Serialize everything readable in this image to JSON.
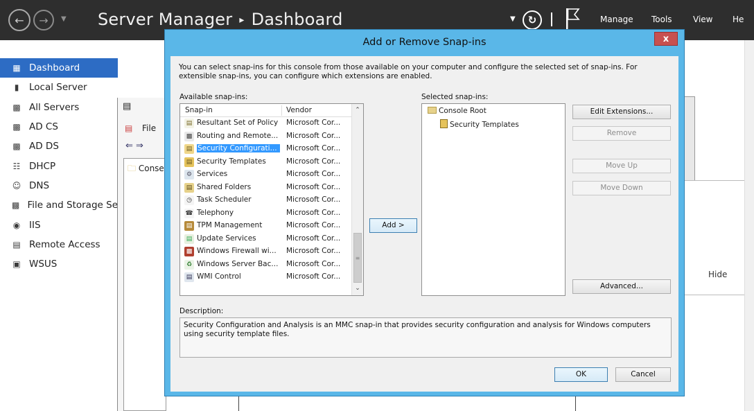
{
  "server_manager": {
    "title": "Server Manager",
    "breadcrumb_sep": "▸",
    "page": "Dashboard",
    "menu": [
      "Manage",
      "Tools",
      "View",
      "He"
    ]
  },
  "sidebar": {
    "items": [
      {
        "label": "Dashboard",
        "icon": "dashboard-icon"
      },
      {
        "label": "Local Server",
        "icon": "server-icon"
      },
      {
        "label": "All Servers",
        "icon": "servers-icon"
      },
      {
        "label": "AD CS",
        "icon": "adcs-icon"
      },
      {
        "label": "AD DS",
        "icon": "adds-icon"
      },
      {
        "label": "DHCP",
        "icon": "dhcp-icon"
      },
      {
        "label": "DNS",
        "icon": "dns-icon"
      },
      {
        "label": "File and Storage Se",
        "icon": "storage-icon"
      },
      {
        "label": "IIS",
        "icon": "iis-icon"
      },
      {
        "label": "Remote Access",
        "icon": "remote-access-icon"
      },
      {
        "label": "WSUS",
        "icon": "wsus-icon"
      }
    ]
  },
  "background_window": {
    "menu_file": "File",
    "tree_item": "Conse",
    "hide_label": "Hide"
  },
  "dialog": {
    "title": "Add or Remove Snap-ins",
    "close": "x",
    "intro": "You can select snap-ins for this console from those available on your computer and configure the selected set of snap-ins. For extensible snap-ins, you can configure which extensions are enabled.",
    "available_label": "Available snap-ins:",
    "selected_label": "Selected snap-ins:",
    "col_snapin": "Snap-in",
    "col_vendor": "Vendor",
    "snapins": [
      {
        "name": "Resultant Set of Policy",
        "vendor": "Microsoft Cor...",
        "icon": "policy-icon"
      },
      {
        "name": "Routing and Remote...",
        "vendor": "Microsoft Cor...",
        "icon": "routing-icon"
      },
      {
        "name": "Security Configurati...",
        "vendor": "Microsoft Cor...",
        "icon": "security-config-icon",
        "selected": true
      },
      {
        "name": "Security Templates",
        "vendor": "Microsoft Cor...",
        "icon": "security-templates-icon"
      },
      {
        "name": "Services",
        "vendor": "Microsoft Cor...",
        "icon": "services-icon"
      },
      {
        "name": "Shared Folders",
        "vendor": "Microsoft Cor...",
        "icon": "shared-folders-icon"
      },
      {
        "name": "Task Scheduler",
        "vendor": "Microsoft Cor...",
        "icon": "task-scheduler-icon"
      },
      {
        "name": "Telephony",
        "vendor": "Microsoft Cor...",
        "icon": "telephony-icon"
      },
      {
        "name": "TPM Management",
        "vendor": "Microsoft Cor...",
        "icon": "tpm-icon"
      },
      {
        "name": "Update Services",
        "vendor": "Microsoft Cor...",
        "icon": "update-services-icon"
      },
      {
        "name": "Windows Firewall wi...",
        "vendor": "Microsoft Cor...",
        "icon": "firewall-icon"
      },
      {
        "name": "Windows Server Bac...",
        "vendor": "Microsoft Cor...",
        "icon": "backup-icon"
      },
      {
        "name": "WMI Control",
        "vendor": "Microsoft Cor...",
        "icon": "wmi-icon"
      }
    ],
    "add_button": "Add >",
    "selected_tree": {
      "root": "Console Root",
      "child": "Security Templates"
    },
    "buttons": {
      "edit_extensions": "Edit Extensions...",
      "remove": "Remove",
      "move_up": "Move Up",
      "move_down": "Move Down",
      "advanced": "Advanced...",
      "ok": "OK",
      "cancel": "Cancel"
    },
    "description_label": "Description:",
    "description": "Security Configuration and Analysis is an MMC snap-in that provides security configuration and analysis for Windows computers using security template files."
  },
  "colors": {
    "header_bg": "#2e2e2e",
    "sidebar_active": "#2d6cc4",
    "dialog_frame": "#5ab7e8",
    "close_button": "#c75050",
    "selection": "#3399ff"
  }
}
